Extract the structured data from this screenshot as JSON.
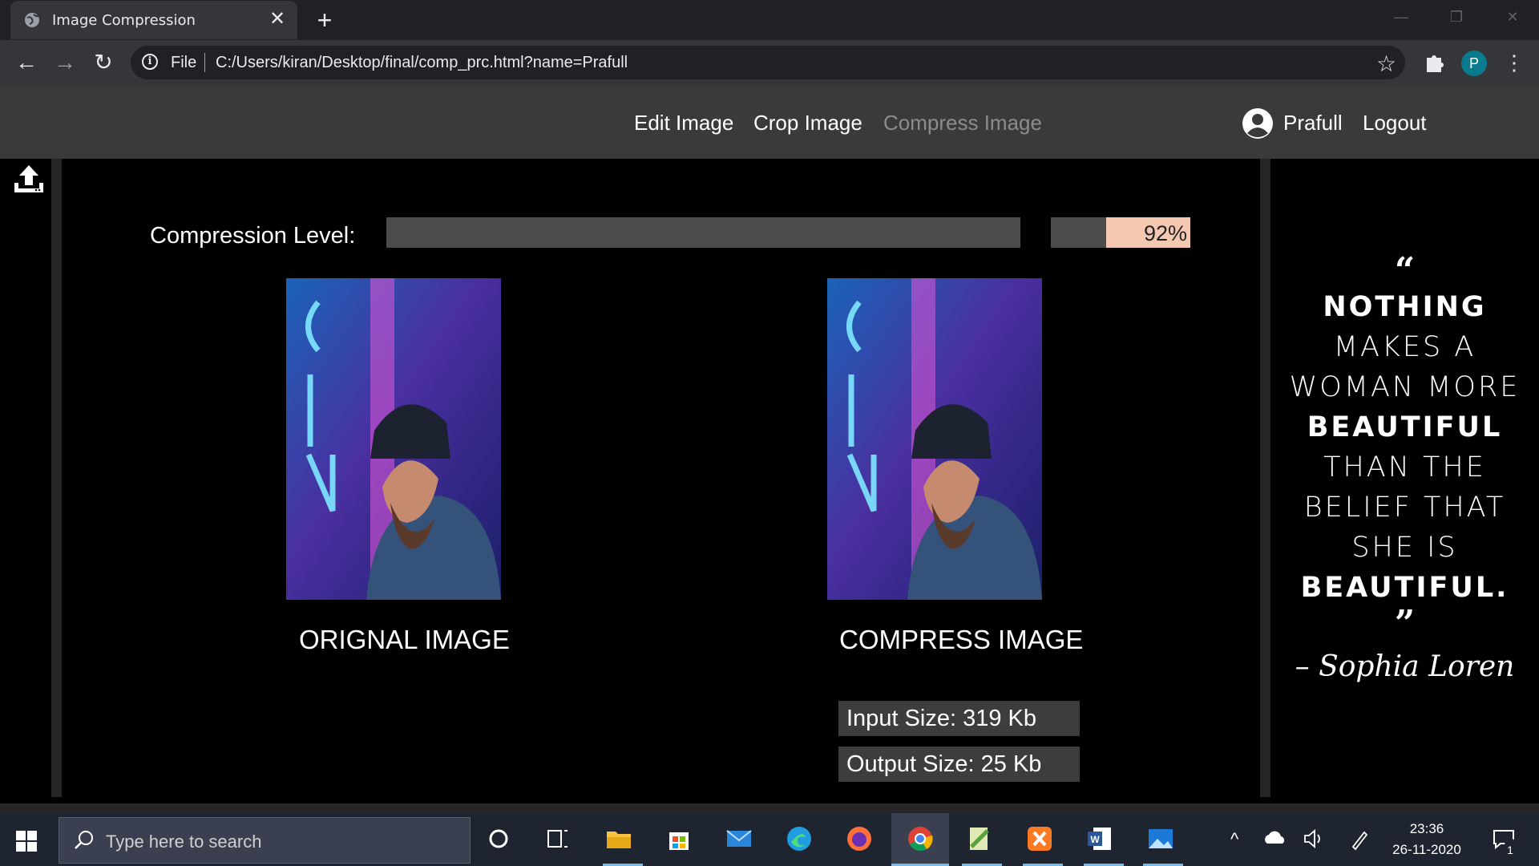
{
  "browser": {
    "tab_title": "Image Compression",
    "address_prefix": "File",
    "url": "C:/Users/kiran/Desktop/final/comp_prc.html?name=Prafull",
    "profile_initial": "P"
  },
  "nav": {
    "links": [
      "Edit Image",
      "Crop Image",
      "Compress Image"
    ],
    "active": "Compress Image",
    "user": "Prafull",
    "logout": "Logout"
  },
  "compression": {
    "label": "Compression Level:",
    "level_percent": 92,
    "display": "92%"
  },
  "images": {
    "original_caption": "ORIGNAL IMAGE",
    "compressed_caption": "COMPRESS IMAGE",
    "input_size": "Input Size: 319 Kb",
    "output_size": "Output Size: 25 Kb"
  },
  "quote": {
    "open_mark": "“",
    "lines": [
      {
        "text": "NOTHING",
        "bold": true
      },
      {
        "text": "MAKES A",
        "bold": false
      },
      {
        "text": "WOMAN MORE",
        "bold": false
      },
      {
        "text": "BEAUTIFUL",
        "bold": true
      },
      {
        "text": "THAN THE",
        "bold": false
      },
      {
        "text": "BELIEF THAT",
        "bold": false
      },
      {
        "text": "SHE IS",
        "bold": false
      },
      {
        "text": "BEAUTIFUL.",
        "bold": true
      }
    ],
    "close_mark": "”",
    "author": "– Sophia Loren"
  },
  "taskbar": {
    "search_placeholder": "Type here to search",
    "time": "23:36",
    "date": "26-11-2020",
    "notification_count": "1"
  },
  "colors": {
    "nav_bg": "#3a3a3a",
    "slider_track": "#4c4c4c",
    "slider_value_bg": "#f4c8b1",
    "size_box_bg": "#3d3d3d",
    "taskbar_bg": "#1f2530"
  }
}
